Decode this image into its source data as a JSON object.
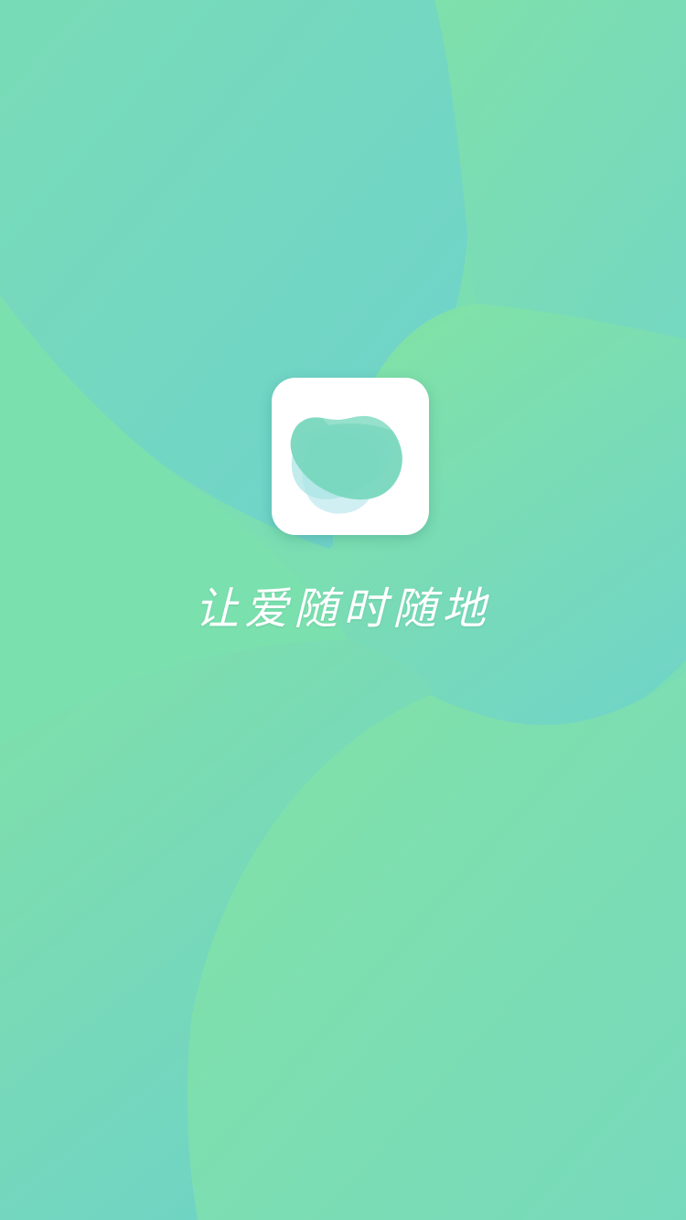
{
  "splash": {
    "slogan": "让爱随时随地",
    "logo_icon": "cloud-blob-logo-icon"
  },
  "colors": {
    "green": "#7fe0a6",
    "teal": "#71d3c8",
    "mint": "#78dcb8",
    "icon_background": "#ffffff"
  }
}
